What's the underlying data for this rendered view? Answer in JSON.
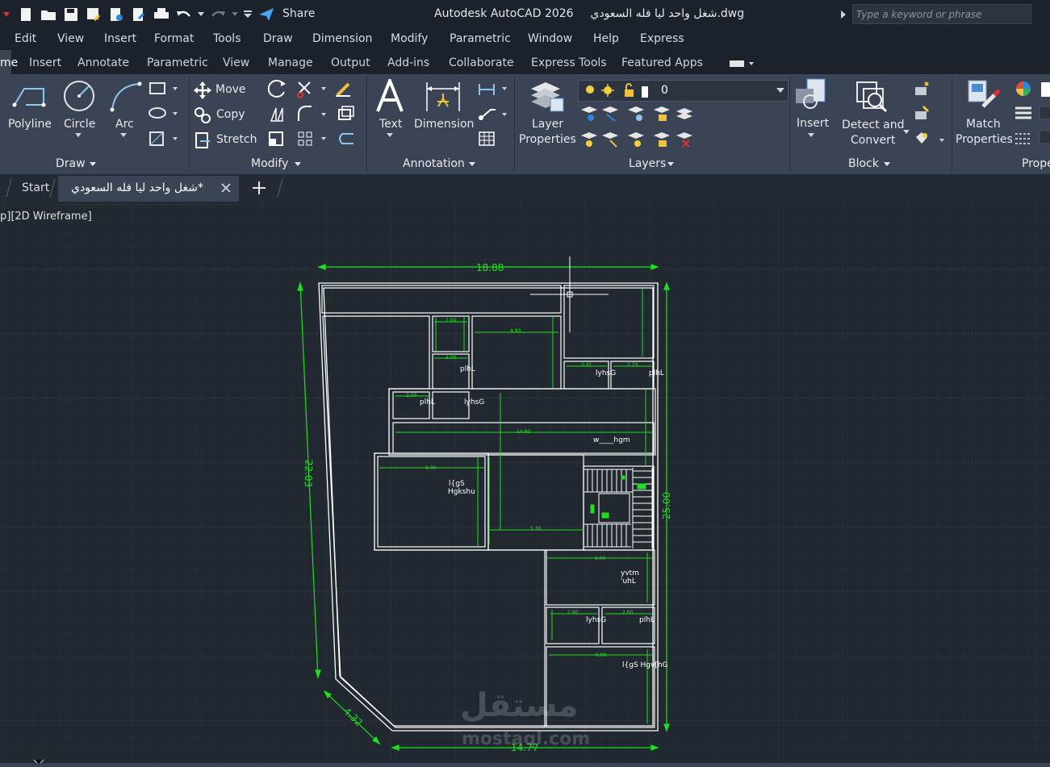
{
  "app": {
    "title": "Autodesk AutoCAD 2026",
    "filename": "شغل واحد ليا فله السعودي.dwg",
    "share_label": "Share",
    "search_placeholder": "Type a keyword or phrase"
  },
  "menu": [
    "Edit",
    "View",
    "Insert",
    "Format",
    "Tools",
    "Draw",
    "Dimension",
    "Modify",
    "Parametric",
    "Window",
    "Help",
    "Express"
  ],
  "ribbon_tabs": [
    "me",
    "Insert",
    "Annotate",
    "Parametric",
    "View",
    "Manage",
    "Output",
    "Add-ins",
    "Collaborate",
    "Express Tools",
    "Featured Apps"
  ],
  "draw_panel": {
    "title": "Draw",
    "polyline": "Polyline",
    "circle": "Circle",
    "arc": "Arc"
  },
  "modify_panel": {
    "title": "Modify",
    "move": "Move",
    "copy": "Copy",
    "stretch": "Stretch"
  },
  "annotation_panel": {
    "title": "Annotation",
    "text": "Text",
    "dimension": "Dimension"
  },
  "layers_panel": {
    "title": "Layers",
    "layer_props_1": "Layer",
    "layer_props_2": "Properties",
    "current_layer": "0"
  },
  "block_panel": {
    "title": "Block",
    "insert": "Insert",
    "detect_1": "Detect and",
    "detect_2": "Convert"
  },
  "properties_panel": {
    "title": "Prope",
    "match_1": "Match",
    "match_2": "Properties"
  },
  "doc_tabs": {
    "start": "Start",
    "active": "شغل واحد ليا فله السعودي*"
  },
  "viewport": {
    "label": "p][2D Wireframe]"
  },
  "drawing": {
    "dims": {
      "top": "18.88",
      "left": "22.03",
      "right": "25.00",
      "bottom": "14.77",
      "diag": "4.32",
      "d1": "2.00",
      "d2": "4.93",
      "d3": "2.00",
      "d4": "2.41",
      "d5": "2.29",
      "d6": "2.00",
      "d7": "14.93",
      "d8": "6.00",
      "d9": "5.30",
      "d10": "6.00",
      "d11": "2.80",
      "d12": "2.80",
      "d13": "6.00"
    },
    "labels": {
      "l1": "plhL",
      "l2": "lyhsG",
      "l3": "plhL",
      "l4": "plhL",
      "l5": "lyhsG",
      "l6": "w____hgm",
      "l7a": "l{gS",
      "l7b": "Hgkshu",
      "l8a": "yvtm",
      "l8b": "'uhL",
      "l9": "lyhsG",
      "l10": "plhL",
      "l11": "l{gS Hgv[hG"
    },
    "watermark_1": "مستقل",
    "watermark_2": "mostaql.com"
  },
  "colors": {
    "dim_green": "#1ee01e",
    "wall_white": "#ffffff",
    "canvas": "#212830",
    "ribbon": "#3b4454"
  }
}
